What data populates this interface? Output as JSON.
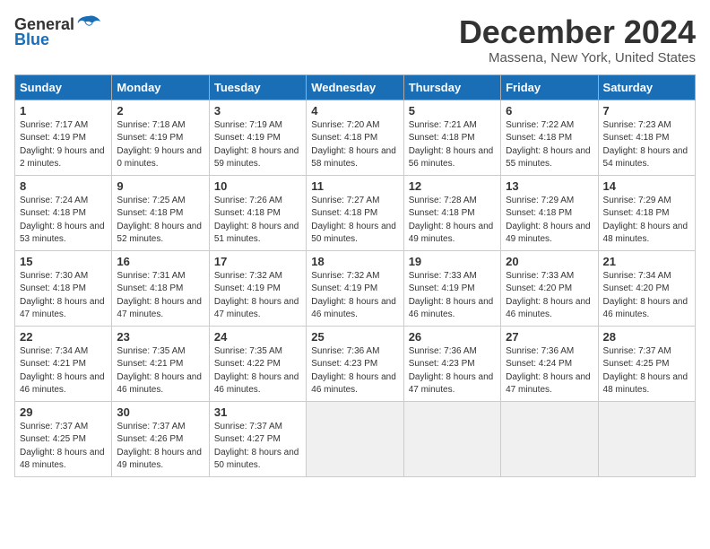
{
  "header": {
    "logo_general": "General",
    "logo_blue": "Blue",
    "month_title": "December 2024",
    "location": "Massena, New York, United States"
  },
  "days_of_week": [
    "Sunday",
    "Monday",
    "Tuesday",
    "Wednesday",
    "Thursday",
    "Friday",
    "Saturday"
  ],
  "weeks": [
    [
      {
        "day": "1",
        "sunrise": "7:17 AM",
        "sunset": "4:19 PM",
        "daylight": "9 hours and 2 minutes."
      },
      {
        "day": "2",
        "sunrise": "7:18 AM",
        "sunset": "4:19 PM",
        "daylight": "9 hours and 0 minutes."
      },
      {
        "day": "3",
        "sunrise": "7:19 AM",
        "sunset": "4:19 PM",
        "daylight": "8 hours and 59 minutes."
      },
      {
        "day": "4",
        "sunrise": "7:20 AM",
        "sunset": "4:18 PM",
        "daylight": "8 hours and 58 minutes."
      },
      {
        "day": "5",
        "sunrise": "7:21 AM",
        "sunset": "4:18 PM",
        "daylight": "8 hours and 56 minutes."
      },
      {
        "day": "6",
        "sunrise": "7:22 AM",
        "sunset": "4:18 PM",
        "daylight": "8 hours and 55 minutes."
      },
      {
        "day": "7",
        "sunrise": "7:23 AM",
        "sunset": "4:18 PM",
        "daylight": "8 hours and 54 minutes."
      }
    ],
    [
      {
        "day": "8",
        "sunrise": "7:24 AM",
        "sunset": "4:18 PM",
        "daylight": "8 hours and 53 minutes."
      },
      {
        "day": "9",
        "sunrise": "7:25 AM",
        "sunset": "4:18 PM",
        "daylight": "8 hours and 52 minutes."
      },
      {
        "day": "10",
        "sunrise": "7:26 AM",
        "sunset": "4:18 PM",
        "daylight": "8 hours and 51 minutes."
      },
      {
        "day": "11",
        "sunrise": "7:27 AM",
        "sunset": "4:18 PM",
        "daylight": "8 hours and 50 minutes."
      },
      {
        "day": "12",
        "sunrise": "7:28 AM",
        "sunset": "4:18 PM",
        "daylight": "8 hours and 49 minutes."
      },
      {
        "day": "13",
        "sunrise": "7:29 AM",
        "sunset": "4:18 PM",
        "daylight": "8 hours and 49 minutes."
      },
      {
        "day": "14",
        "sunrise": "7:29 AM",
        "sunset": "4:18 PM",
        "daylight": "8 hours and 48 minutes."
      }
    ],
    [
      {
        "day": "15",
        "sunrise": "7:30 AM",
        "sunset": "4:18 PM",
        "daylight": "8 hours and 47 minutes."
      },
      {
        "day": "16",
        "sunrise": "7:31 AM",
        "sunset": "4:18 PM",
        "daylight": "8 hours and 47 minutes."
      },
      {
        "day": "17",
        "sunrise": "7:32 AM",
        "sunset": "4:19 PM",
        "daylight": "8 hours and 47 minutes."
      },
      {
        "day": "18",
        "sunrise": "7:32 AM",
        "sunset": "4:19 PM",
        "daylight": "8 hours and 46 minutes."
      },
      {
        "day": "19",
        "sunrise": "7:33 AM",
        "sunset": "4:19 PM",
        "daylight": "8 hours and 46 minutes."
      },
      {
        "day": "20",
        "sunrise": "7:33 AM",
        "sunset": "4:20 PM",
        "daylight": "8 hours and 46 minutes."
      },
      {
        "day": "21",
        "sunrise": "7:34 AM",
        "sunset": "4:20 PM",
        "daylight": "8 hours and 46 minutes."
      }
    ],
    [
      {
        "day": "22",
        "sunrise": "7:34 AM",
        "sunset": "4:21 PM",
        "daylight": "8 hours and 46 minutes."
      },
      {
        "day": "23",
        "sunrise": "7:35 AM",
        "sunset": "4:21 PM",
        "daylight": "8 hours and 46 minutes."
      },
      {
        "day": "24",
        "sunrise": "7:35 AM",
        "sunset": "4:22 PM",
        "daylight": "8 hours and 46 minutes."
      },
      {
        "day": "25",
        "sunrise": "7:36 AM",
        "sunset": "4:23 PM",
        "daylight": "8 hours and 46 minutes."
      },
      {
        "day": "26",
        "sunrise": "7:36 AM",
        "sunset": "4:23 PM",
        "daylight": "8 hours and 47 minutes."
      },
      {
        "day": "27",
        "sunrise": "7:36 AM",
        "sunset": "4:24 PM",
        "daylight": "8 hours and 47 minutes."
      },
      {
        "day": "28",
        "sunrise": "7:37 AM",
        "sunset": "4:25 PM",
        "daylight": "8 hours and 48 minutes."
      }
    ],
    [
      {
        "day": "29",
        "sunrise": "7:37 AM",
        "sunset": "4:25 PM",
        "daylight": "8 hours and 48 minutes."
      },
      {
        "day": "30",
        "sunrise": "7:37 AM",
        "sunset": "4:26 PM",
        "daylight": "8 hours and 49 minutes."
      },
      {
        "day": "31",
        "sunrise": "7:37 AM",
        "sunset": "4:27 PM",
        "daylight": "8 hours and 50 minutes."
      },
      null,
      null,
      null,
      null
    ]
  ]
}
